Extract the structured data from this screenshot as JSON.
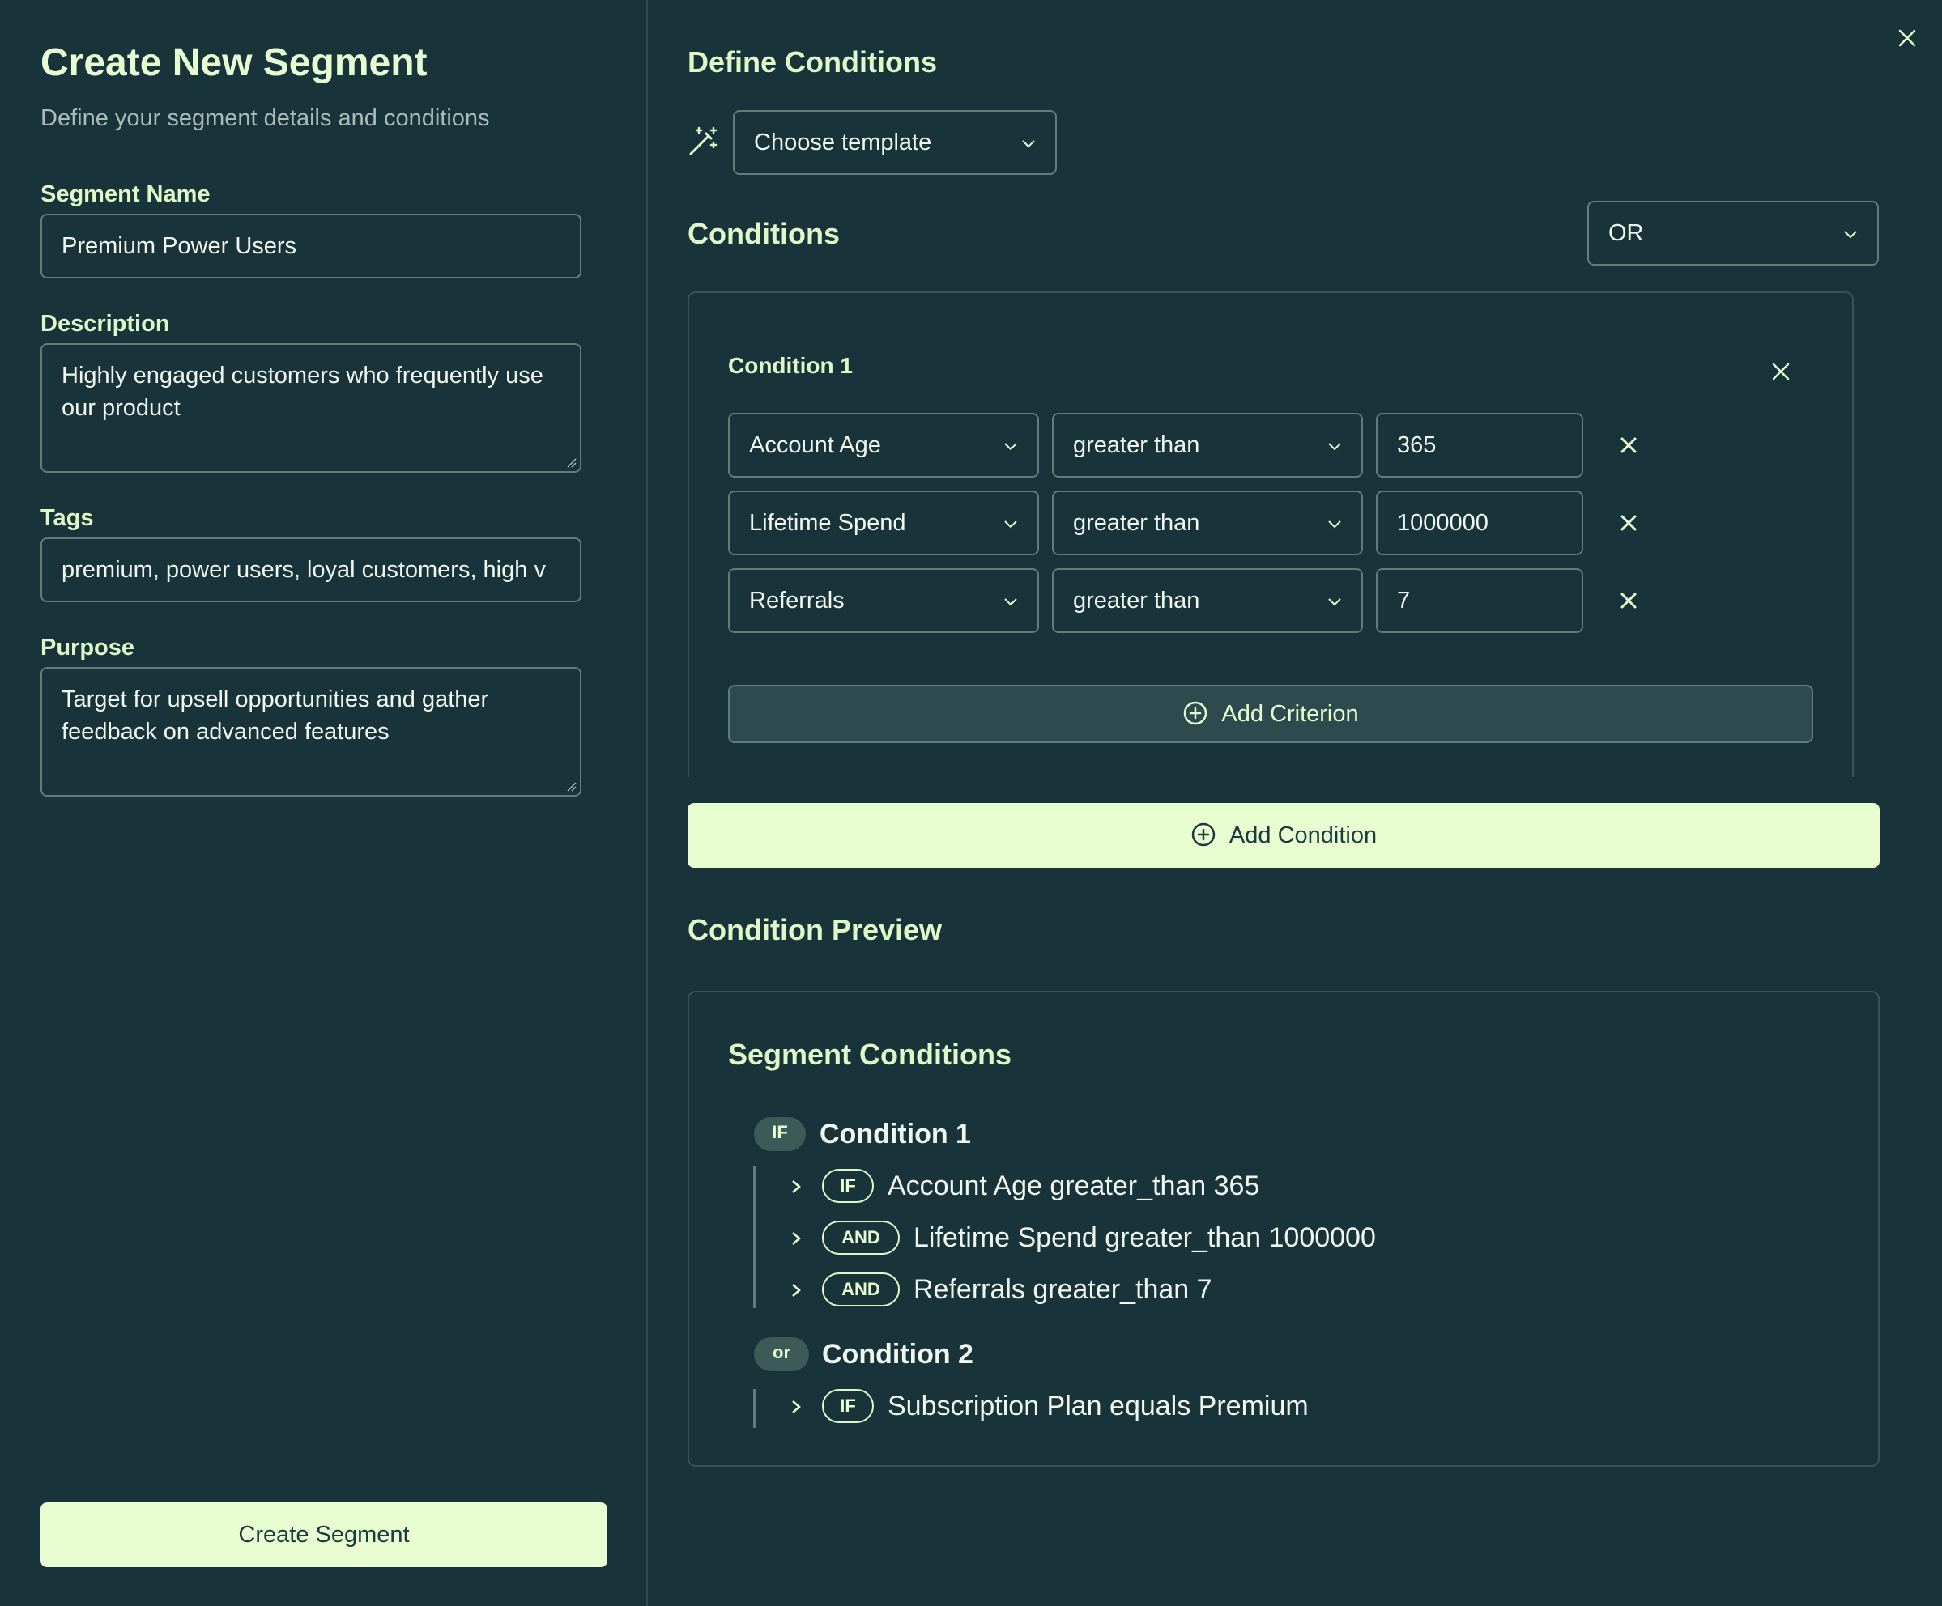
{
  "left": {
    "title": "Create New Segment",
    "subtitle": "Define your segment details and conditions",
    "segment_name": {
      "label": "Segment Name",
      "value": "Premium Power Users"
    },
    "description": {
      "label": "Description",
      "value": "Highly engaged customers who frequently use our product"
    },
    "tags": {
      "label": "Tags",
      "value": "premium, power users, loyal customers, high v"
    },
    "purpose": {
      "label": "Purpose",
      "value": "Target for upsell opportunities and gather feedback on advanced features"
    },
    "create_button": "Create Segment"
  },
  "right": {
    "define_heading": "Define Conditions",
    "template_select": "Choose template",
    "conditions_heading": "Conditions",
    "operator_select": "OR",
    "condition_title": "Condition 1",
    "rows": [
      {
        "field": "Account Age",
        "operator": "greater than",
        "value": "365"
      },
      {
        "field": "Lifetime Spend",
        "operator": "greater than",
        "value": "1000000"
      },
      {
        "field": "Referrals",
        "operator": "greater than",
        "value": "7"
      }
    ],
    "add_criterion": "Add Criterion",
    "add_condition": "Add Condition",
    "preview_heading": "Condition Preview",
    "preview": {
      "title": "Segment Conditions",
      "groups": [
        {
          "badge": "IF",
          "name": "Condition 1",
          "items": [
            {
              "badge": "IF",
              "text": "Account Age greater_than 365"
            },
            {
              "badge": "AND",
              "text": "Lifetime Spend greater_than 1000000"
            },
            {
              "badge": "AND",
              "text": "Referrals greater_than 7"
            }
          ]
        },
        {
          "badge": "or",
          "name": "Condition 2",
          "items": [
            {
              "badge": "IF",
              "text": "Subscription Plan equals Premium"
            }
          ]
        }
      ]
    }
  },
  "colors": {
    "background": "#19333b",
    "accent": "#e8fdd0",
    "border": "#5f7d79"
  }
}
